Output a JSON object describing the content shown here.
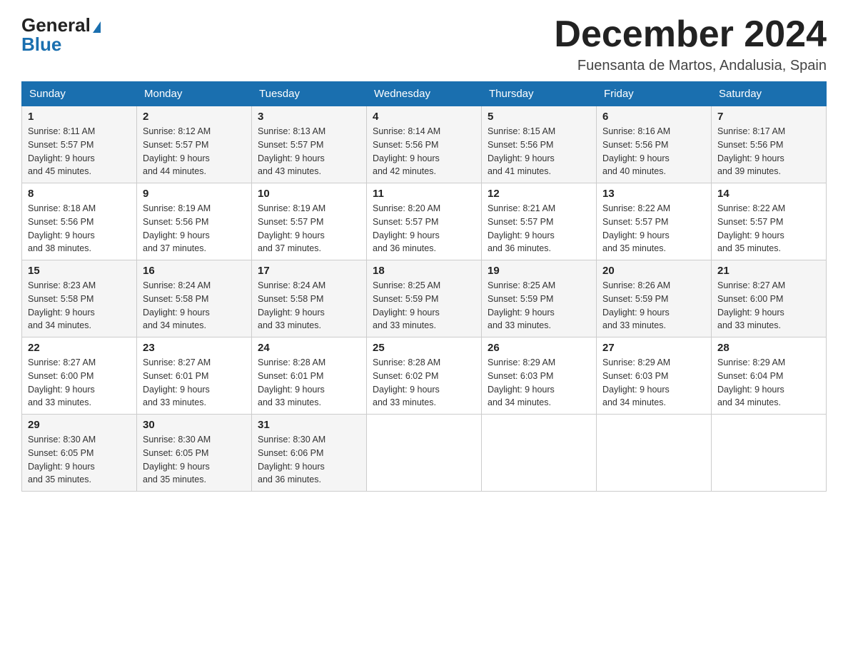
{
  "logo": {
    "general": "General",
    "blue": "Blue"
  },
  "title": "December 2024",
  "location": "Fuensanta de Martos, Andalusia, Spain",
  "days_of_week": [
    "Sunday",
    "Monday",
    "Tuesday",
    "Wednesday",
    "Thursday",
    "Friday",
    "Saturday"
  ],
  "weeks": [
    [
      {
        "day": "1",
        "sunrise": "8:11 AM",
        "sunset": "5:57 PM",
        "daylight": "9 hours and 45 minutes."
      },
      {
        "day": "2",
        "sunrise": "8:12 AM",
        "sunset": "5:57 PM",
        "daylight": "9 hours and 44 minutes."
      },
      {
        "day": "3",
        "sunrise": "8:13 AM",
        "sunset": "5:57 PM",
        "daylight": "9 hours and 43 minutes."
      },
      {
        "day": "4",
        "sunrise": "8:14 AM",
        "sunset": "5:56 PM",
        "daylight": "9 hours and 42 minutes."
      },
      {
        "day": "5",
        "sunrise": "8:15 AM",
        "sunset": "5:56 PM",
        "daylight": "9 hours and 41 minutes."
      },
      {
        "day": "6",
        "sunrise": "8:16 AM",
        "sunset": "5:56 PM",
        "daylight": "9 hours and 40 minutes."
      },
      {
        "day": "7",
        "sunrise": "8:17 AM",
        "sunset": "5:56 PM",
        "daylight": "9 hours and 39 minutes."
      }
    ],
    [
      {
        "day": "8",
        "sunrise": "8:18 AM",
        "sunset": "5:56 PM",
        "daylight": "9 hours and 38 minutes."
      },
      {
        "day": "9",
        "sunrise": "8:19 AM",
        "sunset": "5:56 PM",
        "daylight": "9 hours and 37 minutes."
      },
      {
        "day": "10",
        "sunrise": "8:19 AM",
        "sunset": "5:57 PM",
        "daylight": "9 hours and 37 minutes."
      },
      {
        "day": "11",
        "sunrise": "8:20 AM",
        "sunset": "5:57 PM",
        "daylight": "9 hours and 36 minutes."
      },
      {
        "day": "12",
        "sunrise": "8:21 AM",
        "sunset": "5:57 PM",
        "daylight": "9 hours and 36 minutes."
      },
      {
        "day": "13",
        "sunrise": "8:22 AM",
        "sunset": "5:57 PM",
        "daylight": "9 hours and 35 minutes."
      },
      {
        "day": "14",
        "sunrise": "8:22 AM",
        "sunset": "5:57 PM",
        "daylight": "9 hours and 35 minutes."
      }
    ],
    [
      {
        "day": "15",
        "sunrise": "8:23 AM",
        "sunset": "5:58 PM",
        "daylight": "9 hours and 34 minutes."
      },
      {
        "day": "16",
        "sunrise": "8:24 AM",
        "sunset": "5:58 PM",
        "daylight": "9 hours and 34 minutes."
      },
      {
        "day": "17",
        "sunrise": "8:24 AM",
        "sunset": "5:58 PM",
        "daylight": "9 hours and 33 minutes."
      },
      {
        "day": "18",
        "sunrise": "8:25 AM",
        "sunset": "5:59 PM",
        "daylight": "9 hours and 33 minutes."
      },
      {
        "day": "19",
        "sunrise": "8:25 AM",
        "sunset": "5:59 PM",
        "daylight": "9 hours and 33 minutes."
      },
      {
        "day": "20",
        "sunrise": "8:26 AM",
        "sunset": "5:59 PM",
        "daylight": "9 hours and 33 minutes."
      },
      {
        "day": "21",
        "sunrise": "8:27 AM",
        "sunset": "6:00 PM",
        "daylight": "9 hours and 33 minutes."
      }
    ],
    [
      {
        "day": "22",
        "sunrise": "8:27 AM",
        "sunset": "6:00 PM",
        "daylight": "9 hours and 33 minutes."
      },
      {
        "day": "23",
        "sunrise": "8:27 AM",
        "sunset": "6:01 PM",
        "daylight": "9 hours and 33 minutes."
      },
      {
        "day": "24",
        "sunrise": "8:28 AM",
        "sunset": "6:01 PM",
        "daylight": "9 hours and 33 minutes."
      },
      {
        "day": "25",
        "sunrise": "8:28 AM",
        "sunset": "6:02 PM",
        "daylight": "9 hours and 33 minutes."
      },
      {
        "day": "26",
        "sunrise": "8:29 AM",
        "sunset": "6:03 PM",
        "daylight": "9 hours and 34 minutes."
      },
      {
        "day": "27",
        "sunrise": "8:29 AM",
        "sunset": "6:03 PM",
        "daylight": "9 hours and 34 minutes."
      },
      {
        "day": "28",
        "sunrise": "8:29 AM",
        "sunset": "6:04 PM",
        "daylight": "9 hours and 34 minutes."
      }
    ],
    [
      {
        "day": "29",
        "sunrise": "8:30 AM",
        "sunset": "6:05 PM",
        "daylight": "9 hours and 35 minutes."
      },
      {
        "day": "30",
        "sunrise": "8:30 AM",
        "sunset": "6:05 PM",
        "daylight": "9 hours and 35 minutes."
      },
      {
        "day": "31",
        "sunrise": "8:30 AM",
        "sunset": "6:06 PM",
        "daylight": "9 hours and 36 minutes."
      },
      null,
      null,
      null,
      null
    ]
  ],
  "labels": {
    "sunrise": "Sunrise:",
    "sunset": "Sunset:",
    "daylight": "Daylight:"
  }
}
